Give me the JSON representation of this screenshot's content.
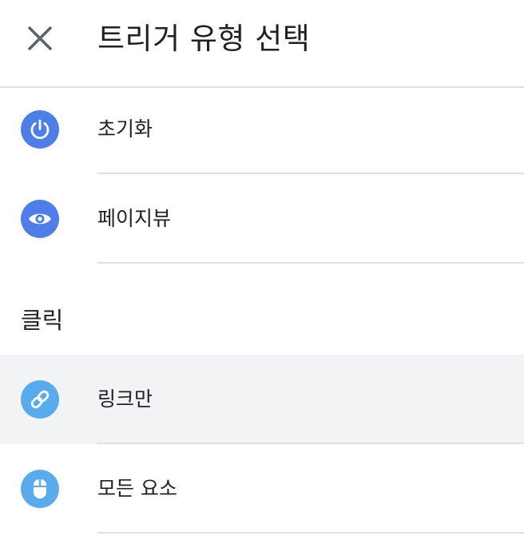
{
  "header": {
    "title": "트리거 유형 선택",
    "close_icon": "close-icon"
  },
  "items": [
    {
      "label": "초기화",
      "icon": "power-icon",
      "icon_color": "#4f7ee8"
    },
    {
      "label": "페이지뷰",
      "icon": "eye-icon",
      "icon_color": "#4f7ee8"
    }
  ],
  "section": {
    "title": "클릭"
  },
  "click_items": [
    {
      "label": "링크만",
      "icon": "link-icon",
      "icon_color": "#5aabeb",
      "selected": true
    },
    {
      "label": "모든 요소",
      "icon": "mouse-icon",
      "icon_color": "#5aabeb",
      "selected": false
    }
  ],
  "colors": {
    "divider": "#e0e0e0",
    "selected_bg": "#f1f3f4",
    "text": "#202124"
  }
}
